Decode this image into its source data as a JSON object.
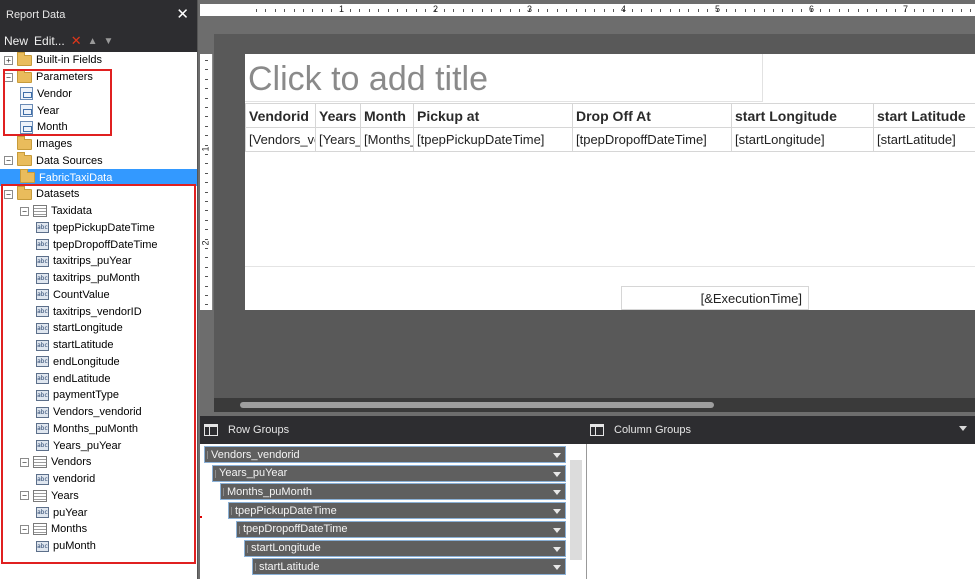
{
  "left_pane": {
    "title": "Report Data",
    "toolbar": {
      "new_label": "New",
      "edit_label": "Edit..."
    },
    "tree": [
      {
        "label": "Built-in Fields",
        "level": 0,
        "icon": "folder",
        "expander": "+"
      },
      {
        "label": "Parameters",
        "level": 0,
        "icon": "folder",
        "expander": "−"
      },
      {
        "label": "Vendor",
        "level": 1,
        "icon": "param"
      },
      {
        "label": "Year",
        "level": 1,
        "icon": "param"
      },
      {
        "label": "Month",
        "level": 1,
        "icon": "param"
      },
      {
        "label": "Images",
        "level": 0,
        "icon": "folder"
      },
      {
        "label": "Data Sources",
        "level": 0,
        "icon": "folder",
        "expander": "−"
      },
      {
        "label": "FabricTaxiData",
        "level": 1,
        "icon": "folder",
        "selected": true
      },
      {
        "label": "Datasets",
        "level": 0,
        "icon": "folder",
        "expander": "−"
      },
      {
        "label": "Taxidata",
        "level": 1,
        "icon": "table",
        "expander": "−"
      },
      {
        "label": "tpepPickupDateTime",
        "level": 2,
        "icon": "field"
      },
      {
        "label": "tpepDropoffDateTime",
        "level": 2,
        "icon": "field"
      },
      {
        "label": "taxitrips_puYear",
        "level": 2,
        "icon": "field"
      },
      {
        "label": "taxitrips_puMonth",
        "level": 2,
        "icon": "field"
      },
      {
        "label": "CountValue",
        "level": 2,
        "icon": "field"
      },
      {
        "label": "taxitrips_vendorID",
        "level": 2,
        "icon": "field"
      },
      {
        "label": "startLongitude",
        "level": 2,
        "icon": "field"
      },
      {
        "label": "startLatitude",
        "level": 2,
        "icon": "field"
      },
      {
        "label": "endLongitude",
        "level": 2,
        "icon": "field"
      },
      {
        "label": "endLatitude",
        "level": 2,
        "icon": "field"
      },
      {
        "label": "paymentType",
        "level": 2,
        "icon": "field"
      },
      {
        "label": "Vendors_vendorid",
        "level": 2,
        "icon": "field"
      },
      {
        "label": "Months_puMonth",
        "level": 2,
        "icon": "field"
      },
      {
        "label": "Years_puYear",
        "level": 2,
        "icon": "field"
      },
      {
        "label": "Vendors",
        "level": 1,
        "icon": "table",
        "expander": "−"
      },
      {
        "label": "vendorid",
        "level": 2,
        "icon": "field"
      },
      {
        "label": "Years",
        "level": 1,
        "icon": "table",
        "expander": "−"
      },
      {
        "label": "puYear",
        "level": 2,
        "icon": "field"
      },
      {
        "label": "Months",
        "level": 1,
        "icon": "table",
        "expander": "−"
      },
      {
        "label": "puMonth",
        "level": 2,
        "icon": "field"
      }
    ]
  },
  "ruler": {
    "top_labels": [
      "1",
      "2",
      "3",
      "4",
      "5",
      "6",
      "7"
    ],
    "left_labels": [
      "1",
      "2"
    ]
  },
  "report": {
    "title_placeholder": "Click to add title",
    "table": {
      "headers": [
        "Vendorid",
        "Years",
        "Month",
        "Pickup at",
        "Drop Off At",
        "start Longitude",
        "start Latitude"
      ],
      "row": [
        "[Vendors_vendorid]",
        "[Years_puYear]",
        "[Months_puMonth]",
        "[tpepPickupDateTime]",
        "[tpepDropoffDateTime]",
        "[startLongitude]",
        "[startLatitude]"
      ]
    },
    "execution_time": "[&ExecutionTime]"
  },
  "grouping": {
    "row_groups_label": "Row Groups",
    "column_groups_label": "Column Groups",
    "row_groups": [
      "Vendors_vendorid",
      "Years_puYear",
      "Months_puMonth",
      "tpepPickupDateTime",
      "tpepDropoffDateTime",
      "startLongitude",
      "startLatitude"
    ]
  },
  "colors": {
    "selection": "#3399ff",
    "annotation": "#e02020",
    "panel": "#2d2d30"
  }
}
